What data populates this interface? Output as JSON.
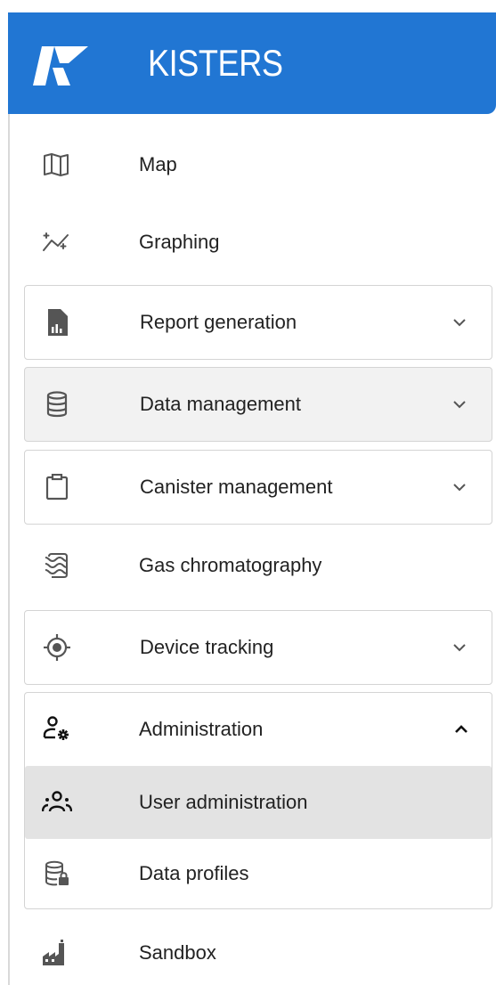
{
  "header": {
    "brand": "KISTERS",
    "logo_icon": "kisters-k-logo",
    "background": "#2176d3"
  },
  "nav": {
    "map": {
      "label": "Map",
      "icon": "map-icon"
    },
    "graphing": {
      "label": "Graphing",
      "icon": "graph-trend-icon"
    },
    "report_generation": {
      "label": "Report generation",
      "icon": "report-file-icon",
      "expanded": false
    },
    "data_management": {
      "label": "Data management",
      "icon": "database-icon",
      "expanded": false
    },
    "canister_management": {
      "label": "Canister management",
      "icon": "clipboard-icon",
      "expanded": false
    },
    "gas_chromatography": {
      "label": "Gas chromatography",
      "icon": "chromatography-icon"
    },
    "device_tracking": {
      "label": "Device tracking",
      "icon": "crosshair-target-icon",
      "expanded": false
    },
    "administration": {
      "label": "Administration",
      "icon": "user-gear-icon",
      "expanded": true,
      "children": [
        {
          "label": "User administration",
          "icon": "user-group-icon",
          "active": true
        },
        {
          "label": "Data profiles",
          "icon": "database-lock-icon",
          "active": false
        }
      ]
    },
    "sandbox": {
      "label": "Sandbox",
      "icon": "sandbox-factory-icon"
    }
  },
  "colors": {
    "accent": "#2176d3",
    "active_bg": "#e3e3e3",
    "hover_bg": "#f2f2f2",
    "icon": "#555555"
  }
}
